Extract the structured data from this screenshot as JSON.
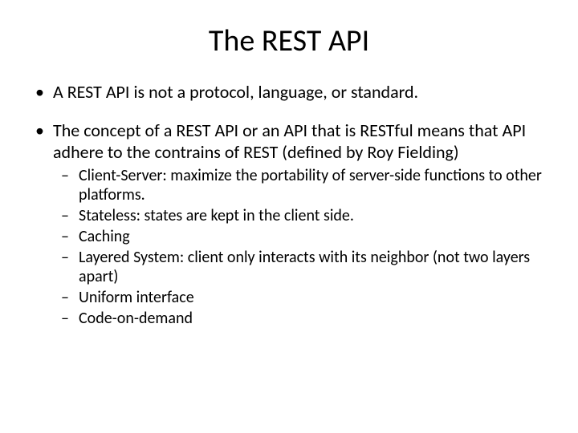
{
  "title": "The REST API",
  "bullets": [
    {
      "text": "A REST API is not a protocol, language, or standard."
    },
    {
      "text": "The concept of a REST API or an API that is RESTful means that API adhere to the contrains of REST (defined by Roy Fielding)",
      "sub": [
        "Client-Server: maximize the portability of server-side functions to other platforms.",
        "Stateless: states are kept in the client side.",
        "Caching",
        "Layered System: client only interacts with its neighbor (not two layers apart)",
        "Uniform interface",
        "Code-on-demand"
      ]
    }
  ]
}
